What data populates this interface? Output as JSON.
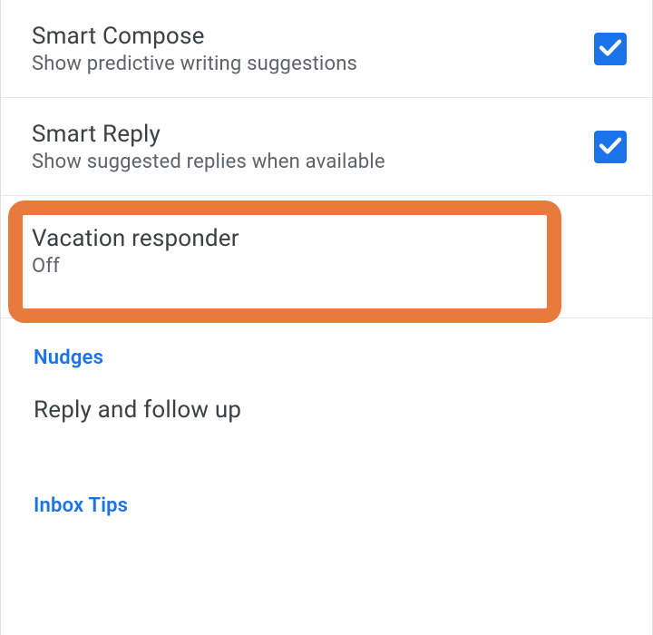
{
  "settings": {
    "smartCompose": {
      "title": "Smart Compose",
      "subtitle": "Show predictive writing suggestions",
      "checked": true
    },
    "smartReply": {
      "title": "Smart Reply",
      "subtitle": "Show suggested replies when available",
      "checked": true
    },
    "vacationResponder": {
      "title": "Vacation responder",
      "status": "Off"
    }
  },
  "sections": {
    "nudges": {
      "header": "Nudges",
      "item": "Reply and follow up"
    },
    "inboxTips": {
      "header": "Inbox Tips"
    }
  }
}
